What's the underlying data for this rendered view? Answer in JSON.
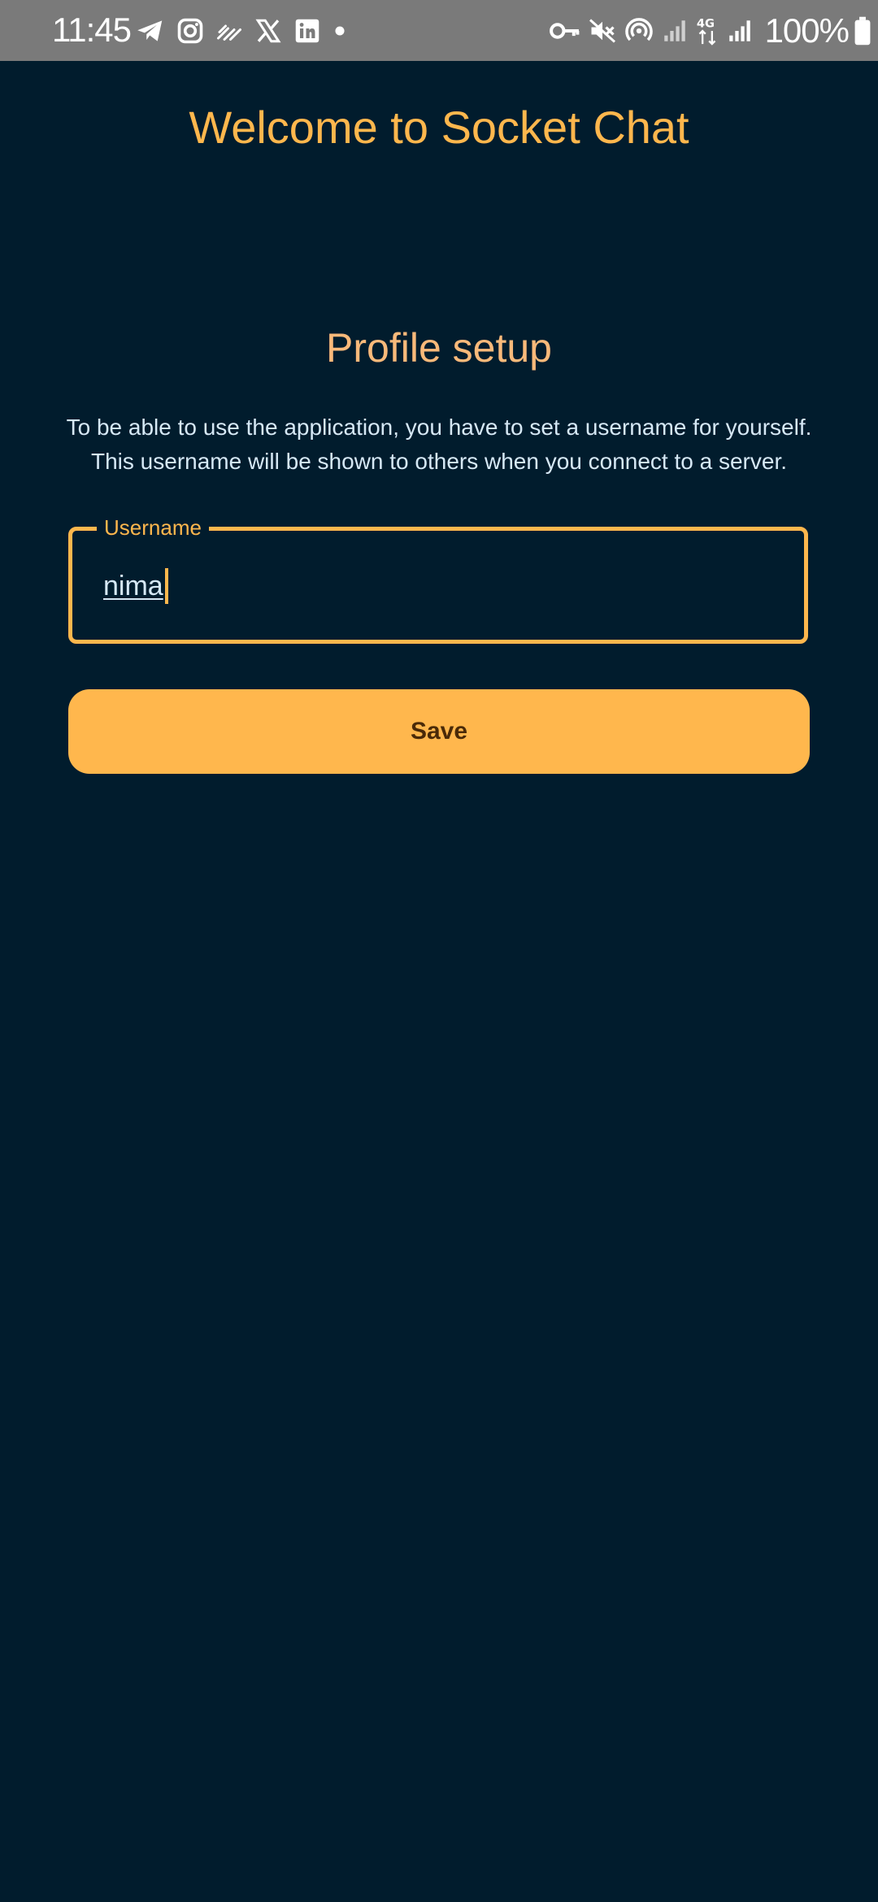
{
  "status_bar": {
    "time": "11:45",
    "battery_percent": "100%",
    "left_icons": [
      "telegram-icon",
      "instagram-icon",
      "streaks-icon",
      "x-icon",
      "linkedin-icon",
      "dot-icon"
    ],
    "right_icons": [
      "key-icon",
      "mute-icon",
      "hotspot-icon",
      "signal-icon",
      "4g-icon",
      "signal-icon",
      "battery-icon"
    ]
  },
  "app": {
    "title": "Welcome to Socket Chat"
  },
  "profile_setup": {
    "heading": "Profile setup",
    "description_line1": "To be able to use the application, you have to set a username for yourself.",
    "description_line2": "This username will be shown to others when you connect to a server.",
    "username_label": "Username",
    "username_value": "nima",
    "save_label": "Save"
  },
  "colors": {
    "background": "#011C2D",
    "accent": "#FFB74D",
    "heading": "#F9B97A",
    "text": "#D6E8F5",
    "button_text": "#4A2A08",
    "status_bar": "#7A7A7A"
  }
}
